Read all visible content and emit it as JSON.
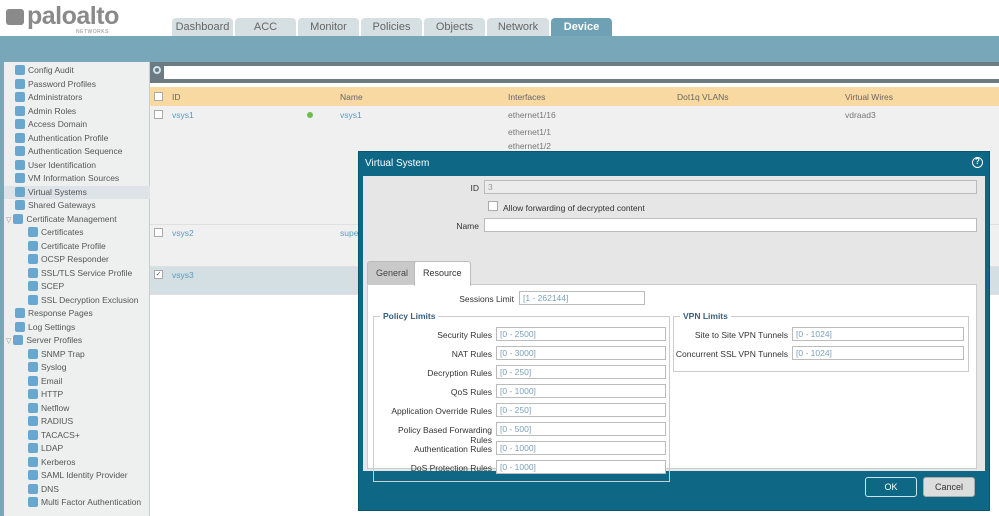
{
  "brand": {
    "name": "paloalto",
    "sub": "NETWORKS"
  },
  "tabs": [
    "Dashboard",
    "ACC",
    "Monitor",
    "Policies",
    "Objects",
    "Network",
    "Device"
  ],
  "active_tab": "Device",
  "sidebar": [
    {
      "label": "Config Audit",
      "level": 0
    },
    {
      "label": "Password Profiles",
      "level": 0
    },
    {
      "label": "Administrators",
      "level": 0
    },
    {
      "label": "Admin Roles",
      "level": 0
    },
    {
      "label": "Access Domain",
      "level": 0
    },
    {
      "label": "Authentication Profile",
      "level": 0
    },
    {
      "label": "Authentication Sequence",
      "level": 0
    },
    {
      "label": "User Identification",
      "level": 0
    },
    {
      "label": "VM Information Sources",
      "level": 0
    },
    {
      "label": "Virtual Systems",
      "level": 0,
      "selected": true
    },
    {
      "label": "Shared Gateways",
      "level": 0
    },
    {
      "label": "Certificate Management",
      "level": 0,
      "expanded": true
    },
    {
      "label": "Certificates",
      "level": 1
    },
    {
      "label": "Certificate Profile",
      "level": 1
    },
    {
      "label": "OCSP Responder",
      "level": 1
    },
    {
      "label": "SSL/TLS Service Profile",
      "level": 1
    },
    {
      "label": "SCEP",
      "level": 1
    },
    {
      "label": "SSL Decryption Exclusion",
      "level": 1
    },
    {
      "label": "Response Pages",
      "level": 0
    },
    {
      "label": "Log Settings",
      "level": 0
    },
    {
      "label": "Server Profiles",
      "level": 0,
      "expanded": true
    },
    {
      "label": "SNMP Trap",
      "level": 1
    },
    {
      "label": "Syslog",
      "level": 1
    },
    {
      "label": "Email",
      "level": 1
    },
    {
      "label": "HTTP",
      "level": 1
    },
    {
      "label": "Netflow",
      "level": 1
    },
    {
      "label": "RADIUS",
      "level": 1
    },
    {
      "label": "TACACS+",
      "level": 1
    },
    {
      "label": "LDAP",
      "level": 1
    },
    {
      "label": "Kerberos",
      "level": 1
    },
    {
      "label": "SAML Identity Provider",
      "level": 1
    },
    {
      "label": "DNS",
      "level": 1
    },
    {
      "label": "Multi Factor Authentication",
      "level": 1
    }
  ],
  "table": {
    "columns": [
      "ID",
      "Name",
      "Interfaces",
      "Dot1q VLANs",
      "Virtual Wires"
    ],
    "rows": [
      {
        "id": "vsys1",
        "name": "vsys1",
        "interfaces": [
          "ethernet1/16",
          "ethernet1/1",
          "ethernet1/2"
        ],
        "wires": "vdraad3"
      },
      {
        "id": "vsys2",
        "name": "supe"
      },
      {
        "id": "vsys3",
        "checked": true
      }
    ]
  },
  "dialog": {
    "title": "Virtual System",
    "id_label": "ID",
    "id_value": "3",
    "allow_fwd": "Allow forwarding of decrypted content",
    "name_label": "Name",
    "name_value": "",
    "tabs": [
      "General",
      "Resource"
    ],
    "sessions_label": "Sessions Limit",
    "sessions_ph": "[1 - 262144]",
    "policy_title": "Policy Limits",
    "policy": [
      {
        "label": "Security Rules",
        "ph": "[0 - 2500]"
      },
      {
        "label": "NAT Rules",
        "ph": "[0 - 3000]"
      },
      {
        "label": "Decryption Rules",
        "ph": "[0 - 250]"
      },
      {
        "label": "QoS Rules",
        "ph": "[0 - 1000]"
      },
      {
        "label": "Application Override Rules",
        "ph": "[0 - 250]"
      },
      {
        "label": "Policy Based Forwarding Rules",
        "ph": "[0 - 500]"
      },
      {
        "label": "Authentication Rules",
        "ph": "[0 - 1000]"
      },
      {
        "label": "DoS Protection Rules",
        "ph": "[0 - 1000]"
      }
    ],
    "vpn_title": "VPN Limits",
    "vpn": [
      {
        "label": "Site to Site VPN Tunnels",
        "ph": "[0 - 1024]"
      },
      {
        "label": "Concurrent SSL VPN Tunnels",
        "ph": "[0 - 1024]"
      }
    ],
    "ok": "OK",
    "cancel": "Cancel"
  }
}
